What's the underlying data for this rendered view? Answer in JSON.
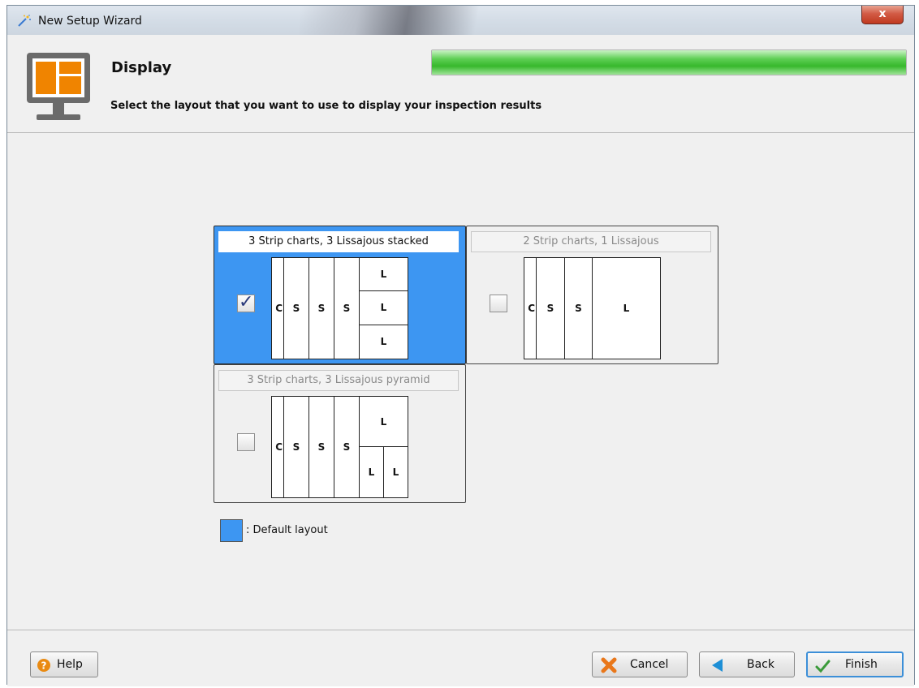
{
  "window": {
    "title": "New Setup Wizard",
    "close_label": "x"
  },
  "header": {
    "title": "Display",
    "subtitle": "Select the layout that you want to use to display your inspection results",
    "progress_percent": 100
  },
  "layouts": [
    {
      "label": "3 Strip charts, 3 Lissajous stacked",
      "checked": true,
      "is_default": true,
      "cells": [
        "C",
        "S",
        "S",
        "S",
        "L",
        "L",
        "L"
      ]
    },
    {
      "label": "2 Strip charts, 1 Lissajous",
      "checked": false,
      "is_default": false,
      "cells": [
        "C",
        "S",
        "S",
        "L"
      ]
    },
    {
      "label": "3 Strip charts, 3 Lissajous pyramid",
      "checked": false,
      "is_default": false,
      "cells": [
        "C",
        "S",
        "S",
        "S",
        "L",
        "L",
        "L"
      ]
    }
  ],
  "legend": {
    "text": ": Default layout",
    "color": "#3d96f2"
  },
  "footer": {
    "help": "Help",
    "cancel": "Cancel",
    "back": "Back",
    "finish": "Finish"
  },
  "colors": {
    "accent": "#3d96f2",
    "progress": "#37b82c",
    "orange": "#f08400"
  }
}
